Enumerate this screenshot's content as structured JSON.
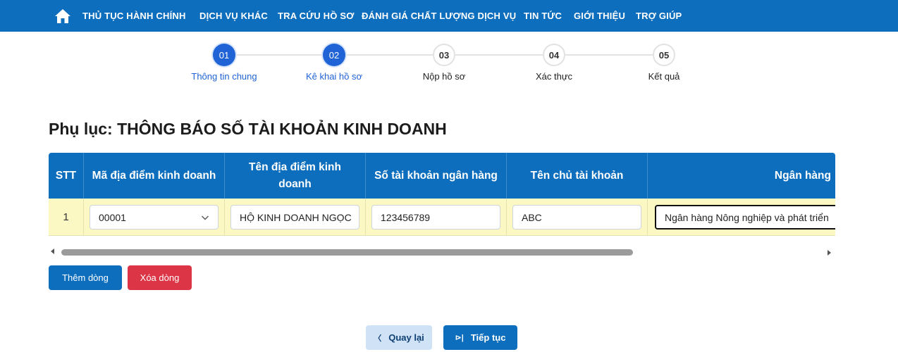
{
  "nav": {
    "home_icon": "home-icon",
    "items": [
      {
        "label": "THỦ TỤC HÀNH CHÍNH"
      },
      {
        "label": "DỊCH VỤ KHÁC"
      },
      {
        "label": "TRA CỨU HỒ SƠ"
      },
      {
        "label": "ĐÁNH GIÁ CHẤT LƯỢNG DỊCH VỤ"
      },
      {
        "label": "TIN TỨC"
      },
      {
        "label": "GIỚI THIỆU"
      },
      {
        "label": "TRỢ GIÚP"
      }
    ]
  },
  "stepper": {
    "steps": [
      {
        "number": "01",
        "label": "Thông tin chung",
        "state": "active"
      },
      {
        "number": "02",
        "label": "Kê khai hồ sơ",
        "state": "active"
      },
      {
        "number": "03",
        "label": "Nộp hồ sơ",
        "state": "pending"
      },
      {
        "number": "04",
        "label": "Xác thực",
        "state": "pending"
      },
      {
        "number": "05",
        "label": "Kết quả",
        "state": "pending"
      }
    ]
  },
  "page": {
    "title": "Phụ lục: THÔNG BÁO SỐ TÀI KHOẢN KINH DOANH"
  },
  "table": {
    "headers": [
      "STT",
      "Mã địa điểm kinh doanh",
      "Tên địa điểm kinh doanh",
      "Số tài khoản ngân hàng",
      "Tên chủ tài khoản",
      "Ngân hàng"
    ],
    "rows": [
      {
        "stt": "1",
        "ma_dia_diem": "00001",
        "ten_dia_diem": "HỘ KINH DOANH NGỌC",
        "so_tai_khoan": "123456789",
        "ten_chu_tai_khoan": "ABC",
        "ngan_hang": "Ngân hàng Nông nghiệp và phát triển"
      }
    ]
  },
  "actions": {
    "add_row": "Thêm dòng",
    "delete_row": "Xóa dòng",
    "back": "Quay lại",
    "next": "Tiếp tục"
  },
  "colors": {
    "primary": "#0d6ebd",
    "step_active": "#1f63d6",
    "danger": "#dc3545",
    "row_highlight": "#fbf8c4",
    "back_button": "#cfe2f6"
  }
}
